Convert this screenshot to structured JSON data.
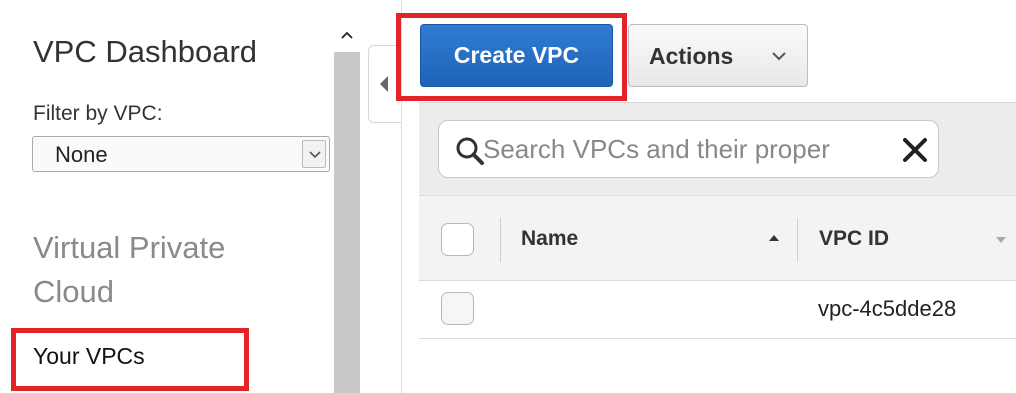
{
  "sidebar": {
    "title": "VPC Dashboard",
    "filter_label": "Filter by VPC:",
    "filter_select": {
      "selected": "None"
    },
    "section_title": "Virtual Private Cloud",
    "nav_items": [
      {
        "label": "Your VPCs",
        "highlighted": true
      }
    ]
  },
  "toolbar": {
    "create_label": "Create VPC",
    "actions_label": "Actions"
  },
  "search": {
    "placeholder": "Search VPCs and their proper"
  },
  "table": {
    "columns": [
      "Name",
      "VPC ID"
    ],
    "rows": [
      {
        "name": "",
        "vpc_id": "vpc-4c5dde28"
      }
    ]
  },
  "colors": {
    "primary_button": "#2370c9",
    "highlight": "#e32426",
    "filter_bar": "#ececec"
  },
  "icons": [
    "chevron-up-icon",
    "chevron-down-icon",
    "collapse-left-icon",
    "search-icon",
    "clear-icon",
    "sort-asc-icon",
    "sort-desc-icon"
  ]
}
